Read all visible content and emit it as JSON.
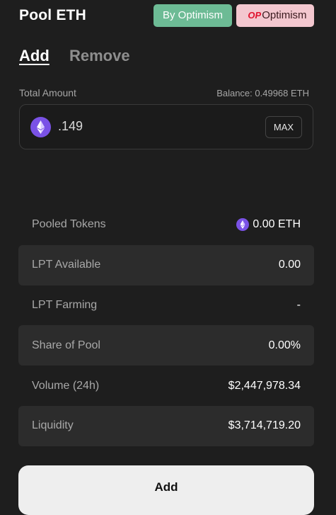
{
  "header": {
    "title": "Pool ETH",
    "badge_by": "By Optimism",
    "badge_op_logo": "OP",
    "badge_op": "Optimism"
  },
  "tabs": {
    "add": "Add",
    "remove": "Remove"
  },
  "amount": {
    "label": "Total Amount",
    "balance": "Balance: 0.49968 ETH",
    "value": ".149",
    "max": "MAX",
    "token_icon": "eth-icon"
  },
  "stats": [
    {
      "label": "Pooled Tokens",
      "value": "0.00 ETH",
      "icon": "eth-icon"
    },
    {
      "label": "LPT Available",
      "value": "0.00"
    },
    {
      "label": "LPT Farming",
      "value": "-"
    },
    {
      "label": "Share of Pool",
      "value": "0.00%"
    },
    {
      "label": "Volume (24h)",
      "value": "$2,447,978.34"
    },
    {
      "label": "Liquidity",
      "value": "$3,714,719.20"
    }
  ],
  "actions": {
    "add": "Add"
  },
  "colors": {
    "background": "#1e1e1e",
    "badge_by": "#6dbb95",
    "badge_op": "#f3c7cf",
    "op_red": "#e0132e",
    "eth_purple": "#7a52e6"
  }
}
